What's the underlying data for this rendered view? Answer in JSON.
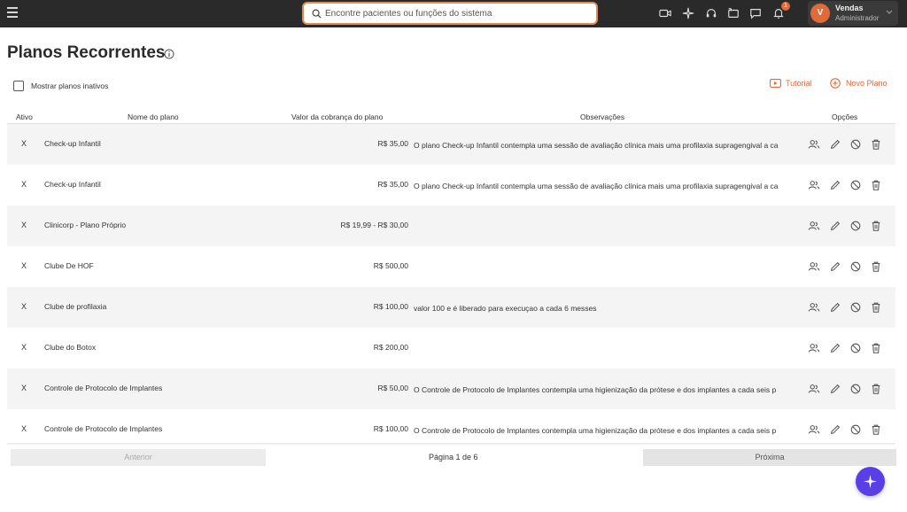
{
  "topbar": {
    "search_placeholder": "Encontre pacientes ou funções do sistema",
    "notification_count": "1",
    "user": {
      "initial": "V",
      "name": "Vendas",
      "role": "Administrador"
    },
    "icons": [
      "menu-icon",
      "search-icon",
      "video-icon",
      "sparkle-icon",
      "headset-icon",
      "announcement-icon",
      "chat-icon",
      "bell-icon",
      "chevron-down-icon"
    ]
  },
  "page": {
    "title": "Planos Recorrentes",
    "show_inactive_label": "Mostrar planos inativos",
    "tutorial_label": "Tutorial",
    "new_plan_label": "Novo Plano"
  },
  "table": {
    "headers": {
      "ativo": "Ativo",
      "nome": "Nome do plano",
      "valor": "Valor da cobrança do plano",
      "obs": "Observações",
      "opcoes": "Opções"
    },
    "rows": [
      {
        "ativo": "X",
        "nome": "Check-up Infantil",
        "valor": "R$ 35,00",
        "obs": "O plano Check-up Infantil contempla uma sessão de avaliação clínica mais uma profilaxia supragengival a ca"
      },
      {
        "ativo": "X",
        "nome": "Check-up Infantil",
        "valor": "R$ 35,00",
        "obs": "O plano Check-up Infantil contempla uma sessão de avaliação clínica mais uma profilaxia supragengival a ca"
      },
      {
        "ativo": "X",
        "nome": "Clinicorp - Plano Próprio",
        "valor": "R$ 19,99 - R$ 30,00",
        "obs": ""
      },
      {
        "ativo": "X",
        "nome": "Clube De HOF",
        "valor": "R$ 500,00",
        "obs": ""
      },
      {
        "ativo": "X",
        "nome": "Clube de profilaxia",
        "valor": "R$ 100,00",
        "obs": "valor 100 e é liberado para execuçao a cada 6 messes"
      },
      {
        "ativo": "X",
        "nome": "Clube do Botox",
        "valor": "R$ 200,00",
        "obs": ""
      },
      {
        "ativo": "X",
        "nome": "Controle de Protocolo de Implantes",
        "valor": "R$ 50,00",
        "obs": "O Controle de Protocolo de Implantes contempla uma higienização da prótese e dos implantes a cada seis p"
      },
      {
        "ativo": "X",
        "nome": "Controle de Protocolo de Implantes",
        "valor": "R$ 100,00",
        "obs": "O Controle de Protocolo de Implantes contempla uma higienização da prótese e dos implantes a cada seis p"
      }
    ],
    "row_action_icons": [
      "users-icon",
      "pencil-icon",
      "block-icon",
      "trash-icon"
    ]
  },
  "pagination": {
    "prev_label": "Anterior",
    "info": "Página 1 de 6",
    "next_label": "Próxima"
  },
  "colors": {
    "accent": "#e06a38",
    "topbar": "#2a2a2a",
    "fab": "#5a3ee6"
  }
}
